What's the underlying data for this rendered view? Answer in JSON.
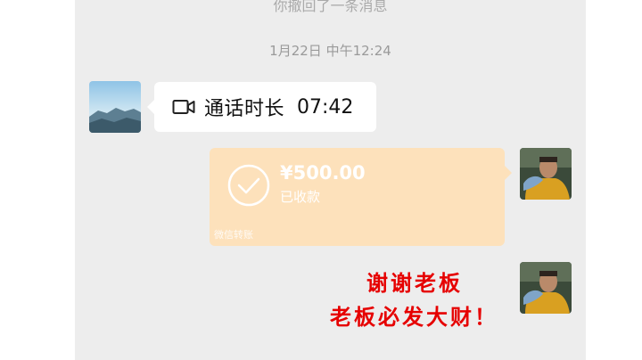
{
  "system_message": "你撤回了一条消息",
  "timestamp": "1月22日 中午12:24",
  "call": {
    "icon": "video-call-icon",
    "label": "通话时长",
    "duration": "07:42"
  },
  "transfer": {
    "icon": "check-circle-icon",
    "amount": "¥500.00",
    "status": "已收款",
    "source": "微信转账",
    "color": "#fde1bb"
  },
  "overlay_text": {
    "line1": "谢谢老板",
    "line2": "老板必发大财！",
    "color": "#e60000"
  },
  "colors": {
    "chat_bg": "#ededed",
    "bubble_bg": "#ffffff"
  }
}
